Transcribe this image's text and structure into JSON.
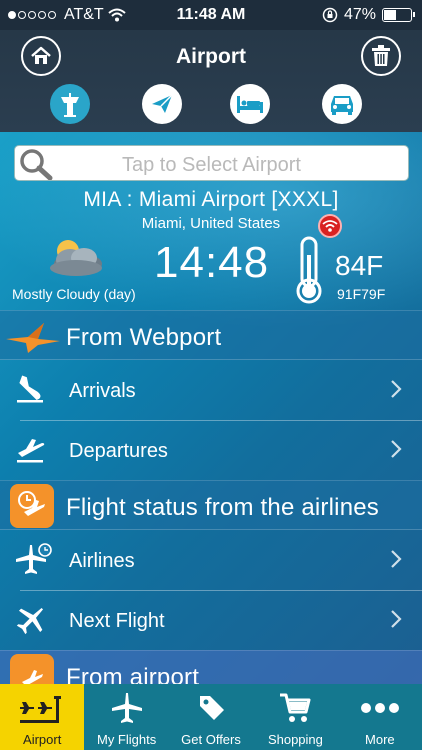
{
  "status_bar": {
    "carrier": "AT&T",
    "time": "11:48 AM",
    "battery": "47%",
    "battery_level": 0.47,
    "signal_bars_filled": 1,
    "signal_bars_total": 5
  },
  "header": {
    "title": "Airport",
    "tabs": [
      {
        "icon": "control-tower-icon",
        "active": true
      },
      {
        "icon": "paper-plane-icon",
        "active": false
      },
      {
        "icon": "hotel-bed-icon",
        "active": false
      },
      {
        "icon": "car-icon",
        "active": false
      }
    ]
  },
  "search": {
    "placeholder": "Tap to Select Airport"
  },
  "airport": {
    "name": "MIA : Miami Airport [XXXL]",
    "city": "Miami, United States",
    "local_time": "14:48",
    "weather": "Mostly Cloudy (day)",
    "temperature": "84F",
    "temp_range": "91F79F"
  },
  "sections": {
    "webport": {
      "label": "From Webport",
      "rows": [
        {
          "label": "Arrivals",
          "icon": "arrival-plane-icon"
        },
        {
          "label": "Departures",
          "icon": "departure-plane-icon"
        }
      ]
    },
    "airlines": {
      "label": "Flight status from the airlines",
      "rows": [
        {
          "label": "Airlines",
          "icon": "airline-clock-icon"
        },
        {
          "label": "Next Flight",
          "icon": "next-flight-icon"
        }
      ]
    },
    "from_airport": {
      "label": "From airport"
    }
  },
  "tab_bar": {
    "items": [
      {
        "label": "Airport",
        "icon": "airport-icon",
        "selected": true
      },
      {
        "label": "My Flights",
        "icon": "plane-icon",
        "selected": false
      },
      {
        "label": "Get Offers",
        "icon": "tag-icon",
        "selected": false
      },
      {
        "label": "Shopping",
        "icon": "cart-icon",
        "selected": false
      },
      {
        "label": "More",
        "icon": "more-dots-icon",
        "selected": false
      }
    ]
  },
  "colors": {
    "accent_blue": "#2aa5c9",
    "orange": "#f4922a",
    "selected_tab": "#f5d300",
    "tab_bar": "#14788f"
  }
}
